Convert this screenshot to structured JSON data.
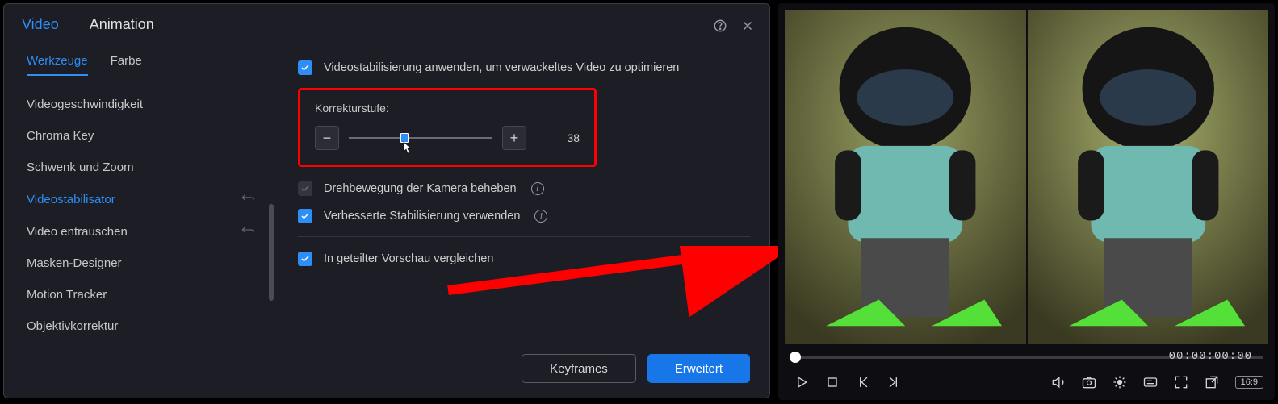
{
  "header": {
    "tabs": {
      "video": "Video",
      "animation": "Animation"
    }
  },
  "sidebar": {
    "subtabs": {
      "tools": "Werkzeuge",
      "color": "Farbe"
    },
    "items": [
      "Videogeschwindigkeit",
      "Chroma Key",
      "Schwenk und Zoom",
      "Videostabilisator",
      "Video entrauschen",
      "Masken-Designer",
      "Motion Tracker",
      "Objektivkorrektur"
    ]
  },
  "content": {
    "apply_label": "Videostabilisierung anwenden, um verwackeltes Video zu optimieren",
    "correction": {
      "label": "Korrekturstufe:",
      "value": "38"
    },
    "fix_rotation": "Drehbewegung der Kamera beheben",
    "enhanced_stab": "Verbesserte Stabilisierung verwenden",
    "split_preview": "In geteilter Vorschau vergleichen"
  },
  "footer": {
    "keyframes": "Keyframes",
    "advanced": "Erweitert"
  },
  "preview": {
    "timecode": "00:00:00:00",
    "aspect": "16:9"
  },
  "colors": {
    "accent": "#2f8ef5",
    "highlight": "#ff0000"
  }
}
